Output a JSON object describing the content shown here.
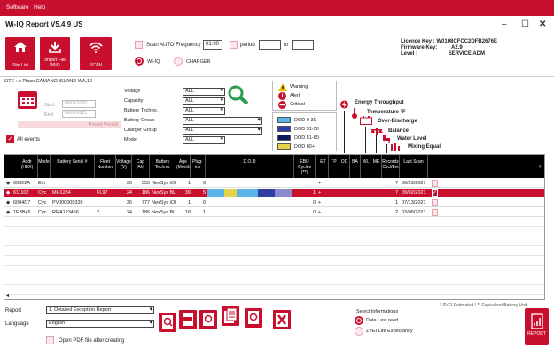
{
  "menu": {
    "software": "Software",
    "help": "Help"
  },
  "window": {
    "title": "Wi-IQ Report V5.4.9 US",
    "minimize": "–",
    "maximize": "☐",
    "close": "✕"
  },
  "ribbon": {
    "site_list": "Site List",
    "import_file": "Import File WIIQ",
    "scan": "SCAN",
    "scan_auto_label": "Scan AUTO Frequency",
    "scan_auto_value": "01:00",
    "period_label": "period",
    "period_from": "",
    "to_label": "to",
    "period_to": "",
    "mode_wiiq": "WI-IQ",
    "mode_charger": "CHARGER",
    "licence_key_label": "Licence Key :",
    "licence_key_value": "W0108CFCC2DFB2676E",
    "firmware_label": "Firmware Key:",
    "firmware_value": "A2.9",
    "level_label": "Level :",
    "level_value": "SERVICE ADM"
  },
  "filters": {
    "site": "SITE : A Place,CAMANO ISLAND WA,12",
    "start_label": "Start",
    "start_value": "09/03/2020",
    "end_label": "End",
    "end_value": "09/02/2021",
    "preset_period": "Preset Period",
    "all_events": "All events",
    "fields": [
      {
        "label": "Voltage",
        "value": "ALL"
      },
      {
        "label": "Capacity",
        "value": "ALL"
      },
      {
        "label": "Battery Techno.",
        "value": "ALL"
      },
      {
        "label": "Battery Group",
        "value": "ALL"
      },
      {
        "label": "Charger Group",
        "value": "ALL"
      },
      {
        "label": "Mode",
        "value": "ALL"
      }
    ],
    "legend_status": [
      "Warning",
      "Alert",
      "Critical"
    ],
    "legend_dod": [
      {
        "label": "DOD 0-30",
        "color": "#5ab4e5"
      },
      {
        "label": "DOD 31-50",
        "color": "#2e3fa3"
      },
      {
        "label": "DOD 51-80",
        "color": "#0b1a5e"
      },
      {
        "label": "DOD 80+",
        "color": "#e8d24a"
      }
    ],
    "icons_legend": [
      "Energy Throughput",
      "Temperature °F",
      "Over-Discharge",
      "Balance",
      "Water Level",
      "Mixing Equal"
    ]
  },
  "table": {
    "headers": [
      "Addr (HEX)",
      "Mode",
      "Battery Serial #",
      "Fleet Number",
      "Voltage (V)",
      "Cap (Ah)",
      "Battery Techno.",
      "Age (Month)",
      "Plug-ins",
      "D.O.D",
      "EBU Cycles (**)",
      "ET",
      "TP",
      "OD",
      "BA",
      "WL",
      "ME",
      "Records Cycl/Evt",
      "Last Scan"
    ],
    "rows": [
      {
        "addr": "60022A",
        "mode": "Evt",
        "serial": "",
        "fleet": "",
        "volt": "36",
        "cap": "555",
        "techno": "NexSys iON",
        "age": "1",
        "plugs": "0",
        "ebu": "",
        "records": "7",
        "last": "06/29/2021",
        "checked": false,
        "selected": false
      },
      {
        "addr": "611102",
        "mode": "Cyc",
        "serial": "MH1234",
        "fleet": "FL97",
        "volt": "24",
        "cap": "186",
        "techno": "NexSys BLOC",
        "age": "39",
        "plugs": "5",
        "ebu": "1",
        "records": "7",
        "last": "09/02/2021",
        "checked": true,
        "selected": true
      },
      {
        "addr": "6004D7",
        "mode": "Cyc",
        "serial": "PVJ00000339",
        "fleet": "",
        "volt": "36",
        "cap": "777",
        "techno": "NexSys iON",
        "age": "1",
        "plugs": "0",
        "ebu": "0",
        "records": "1",
        "last": "07/13/2021",
        "checked": false,
        "selected": false
      },
      {
        "addr": "1E3B45",
        "mode": "Cyc",
        "serial": "RRA123456",
        "fleet": "2",
        "volt": "24",
        "cap": "186",
        "techno": "NexSys BLOC",
        "age": "18",
        "plugs": "1",
        "ebu": "0",
        "records": "2",
        "last": "03/08/2021",
        "checked": false,
        "selected": false
      }
    ],
    "dod_segments": [
      {
        "color": "#5ab4e5",
        "fraction": 0.2
      },
      {
        "color": "#e8d24a",
        "fraction": 0.15
      },
      {
        "color": "#5ab4e5",
        "fraction": 0.25
      },
      {
        "color": "#2e3fa3",
        "fraction": 0.2
      },
      {
        "color": "#8a8acc",
        "fraction": 0.2
      }
    ],
    "scroll_left": "◂"
  },
  "bottom": {
    "report_label": "Report",
    "report_value": "1. Detailed Exception Report",
    "language_label": "Language",
    "language_value": "English",
    "open_pdf": "Open PDF file after creating",
    "footnote": "* ZVEI Estimated / ** Equivalent Battery Unit",
    "select_info": "Select Informations",
    "date_last_read": "Date Last read",
    "zvei_life": "ZVEI Life Expectancy",
    "report_btn": "REPORT"
  },
  "colors": {
    "accent": "#c8102e"
  }
}
